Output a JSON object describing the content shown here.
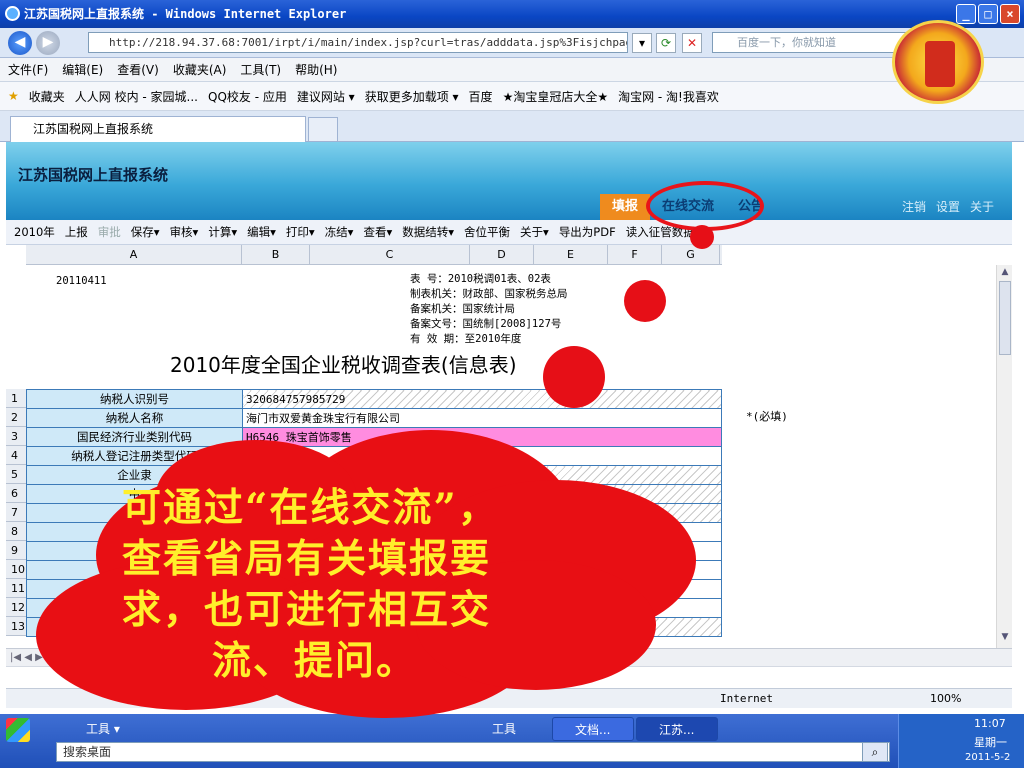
{
  "window": {
    "title": "江苏国税网上直报系统 - Windows Internet Explorer",
    "controls": [
      "_",
      "□",
      "×"
    ]
  },
  "address": {
    "url": "http://218.94.37.68:7001/irpt/i/main/index.jsp?curl=tras/adddata.jsp%3Fisjchpage=tr",
    "search_placeholder": "百度一下，你就知道"
  },
  "menu": [
    "文件(F)",
    "编辑(E)",
    "查看(V)",
    "收藏夹(A)",
    "工具(T)",
    "帮助(H)"
  ],
  "favorites": {
    "label": "收藏夹",
    "items": [
      "人人网 校内 - 家园城...",
      "QQ校友 - 应用",
      "建议网站 ▾",
      "获取更多加载项 ▾",
      "百度",
      "★淘宝皇冠店大全★",
      "淘宝网 - 淘!我喜欢"
    ]
  },
  "tab": {
    "label": "江苏国税网上直报系统"
  },
  "system": {
    "title": "江苏国税网上直报系统",
    "nav": [
      "填报",
      "在线交流",
      "公告"
    ],
    "links": [
      "注销",
      "设置",
      "关于"
    ]
  },
  "toolbar": {
    "items": [
      "2010年",
      "上报",
      "审批",
      "保存▾",
      "审核▾",
      "计算▾",
      "编辑▾",
      "打印▾",
      "冻结▾",
      "查看▾",
      "数据结转▾",
      "舍位平衡",
      "关于▾",
      "导出为PDF",
      "读入征管数据"
    ]
  },
  "sheet": {
    "columns": [
      "A",
      "B",
      "C",
      "D",
      "E",
      "F",
      "G"
    ],
    "doc_id": "20110411",
    "meta": [
      "表    号：2010税调01表、02表",
      "制表机关：财政部、国家税务总局",
      "备案机关：国家统计局",
      "备案文号：国统制[2008]127号",
      "有 效 期：至2010年度"
    ],
    "form_title": "2010年度全国企业税收调查表(信息表)",
    "row_numbers": [
      "1",
      "2",
      "3",
      "4",
      "5",
      "6",
      "7",
      "8",
      "9",
      "10",
      "11",
      "12",
      "13"
    ],
    "rows": [
      {
        "label": "纳税人识别号",
        "value": "320684757985729"
      },
      {
        "label": "纳税人名称",
        "value": "海门市双爱黄金珠宝行有限公司"
      },
      {
        "label": "国民经济行业类别代码",
        "value": "H6546 珠宝首饰零售"
      },
      {
        "label": "纳税人登记注册类型代码",
        "value": ""
      },
      {
        "label": "企业隶",
        "value": ""
      },
      {
        "label": "中",
        "value": ""
      },
      {
        "label": "",
        "value": ""
      },
      {
        "label": "所在",
        "value": ""
      },
      {
        "label": "",
        "value": ""
      },
      {
        "label": "",
        "value": ""
      },
      {
        "label": "",
        "value": ""
      },
      {
        "label": "",
        "value": ""
      },
      {
        "label": "",
        "value": ""
      }
    ],
    "required_note": "*(必填)"
  },
  "statusbar": {
    "zone": "Internet",
    "zoom": "100%"
  },
  "taskbar": {
    "items": [
      "工具 ▾",
      "工具",
      "文档...",
      "江苏..."
    ],
    "search_placeholder": "搜索桌面",
    "time": "11:07",
    "day": "星期一",
    "date": "2011-5-2"
  },
  "annotation": {
    "lines": [
      "可通过“在线交流”，",
      "查看省局有关填报要",
      "求，也可进行相互交",
      "流、提问。"
    ]
  },
  "colors": {
    "accent": "#ef8b1e",
    "annotation_red": "#e80f14",
    "annotation_text": "#ffef2b",
    "header_blue": "#3aa8d9"
  }
}
